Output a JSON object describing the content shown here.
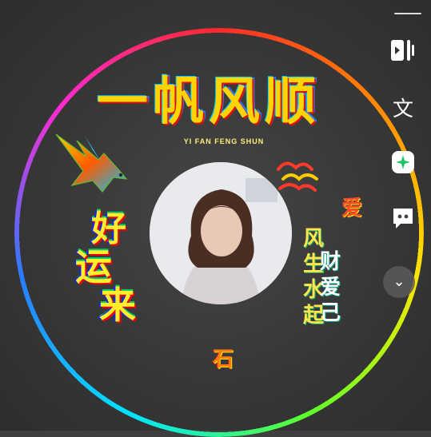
{
  "poster": {
    "title_cn": "一帆风顺",
    "title_pinyin": "YI FAN FENG SHUN",
    "goodluck": [
      "好",
      "运",
      "来"
    ],
    "col_a": [
      "风",
      "生",
      "水",
      "起"
    ],
    "col_b": [
      "财",
      "爱",
      "己"
    ],
    "col_c": [
      "爱"
    ],
    "name": "石"
  },
  "sidebar": {
    "translate_label": "文"
  },
  "icons": {
    "split": "split-screen-icon",
    "translate": "translate-icon",
    "ai": "ai-sparkle-icon",
    "chat": "chat-bubble-icon",
    "collapse": "chevron-down-icon"
  }
}
